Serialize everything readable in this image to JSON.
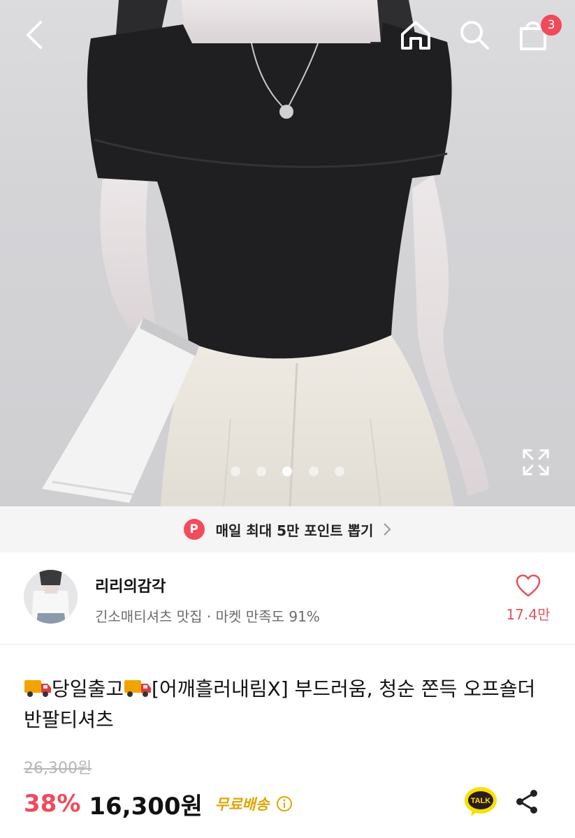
{
  "header": {
    "back_icon": "chevron-left-icon",
    "home_icon": "home-icon",
    "search_icon": "search-icon",
    "cart_icon": "shopping-bag-icon",
    "cart_count": "3"
  },
  "gallery": {
    "dot_count": 5,
    "active_index": 2,
    "expand_icon": "expand-icon"
  },
  "promo": {
    "badge": "P",
    "text": "매일 최대 5만 포인트 뽑기"
  },
  "seller": {
    "name": "리리의감각",
    "description": "긴소매티셔츠 맛집 · 마켓 만족도 91%",
    "like_count": "17.4만"
  },
  "product": {
    "title_part1": "당일출고",
    "title_part2": "[어깨흘러내림X] 부드러움, 청순 쫀득 오프숄더 반팔티셔츠",
    "original_price": "26,300원",
    "discount": "38%",
    "price": "16,300원",
    "shipping": "무료배송"
  },
  "actions": {
    "talk_label": "TALK",
    "share_icon": "share-icon"
  },
  "colors": {
    "accent": "#f04a5b",
    "shipping": "#e0a400",
    "muted": "#6c6c6c"
  }
}
